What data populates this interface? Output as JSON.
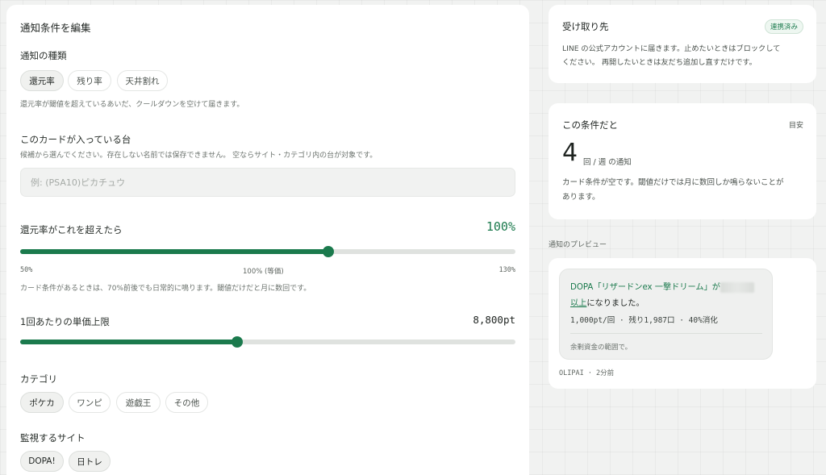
{
  "edit": {
    "title": "通知条件を編集",
    "type_label": "通知の種類",
    "types": [
      "還元率",
      "残り率",
      "天井割れ"
    ],
    "type_help": "還元率が閾値を超えているあいだ、クールダウンを空けて届きます。",
    "card_label": "このカードが入っている台",
    "card_help": "候補から選んでください。存在しない名前では保存できません。 空ならサイト・カテゴリ内の台が対象です。",
    "card_placeholder": "例: (PSA10)ピカチュウ",
    "rate_label": "還元率がこれを超えたら",
    "rate_value": "100%",
    "rate_level": 0.622,
    "rate_min": "50%",
    "rate_mid": "100% (等価)",
    "rate_max": "130%",
    "rate_help": "カード条件があるときは、70%前後でも日常的に鳴ります。閾値だけだと月に数回です。",
    "price_label": "1回あたりの単価上限",
    "price_value": "8,800pt",
    "price_level": 0.438,
    "category_label": "カテゴリ",
    "categories": [
      "ポケカ",
      "ワンピ",
      "遊戯王",
      "その他"
    ],
    "site_label": "監視するサイト",
    "sites": [
      "DOPA!",
      "日トレ"
    ]
  },
  "recipient": {
    "title": "受け取り先",
    "badge": "連携済み",
    "line1": "LINE の公式アカウントに届きます。止めたいときはブロックして",
    "line2": "ください。 再開したいときは友だち追加し直すだけです。"
  },
  "estimate": {
    "title": "この条件だと",
    "tag": "目安",
    "count": "4",
    "unit": "回 / 週 の通知",
    "note1": "カード条件が空です。閾値だけでは月に数回しか鳴らないことが",
    "note2": "あります。"
  },
  "preview": {
    "label": "通知のプレビュー",
    "msg_part1": "DOPA「リザードンex 一撃ドリーム」が",
    "msg_part2": "以上",
    "msg_part3": "になりました。",
    "stats": "1,000pt/回 · 残り1,987口 · 40%消化",
    "footer": "余剰資金の範囲で。",
    "sender": "OLIPAI · 2分前"
  },
  "colors": {
    "accent": "#1b7a4d",
    "track": "#dfe2df",
    "background": "#f1f2f1"
  }
}
